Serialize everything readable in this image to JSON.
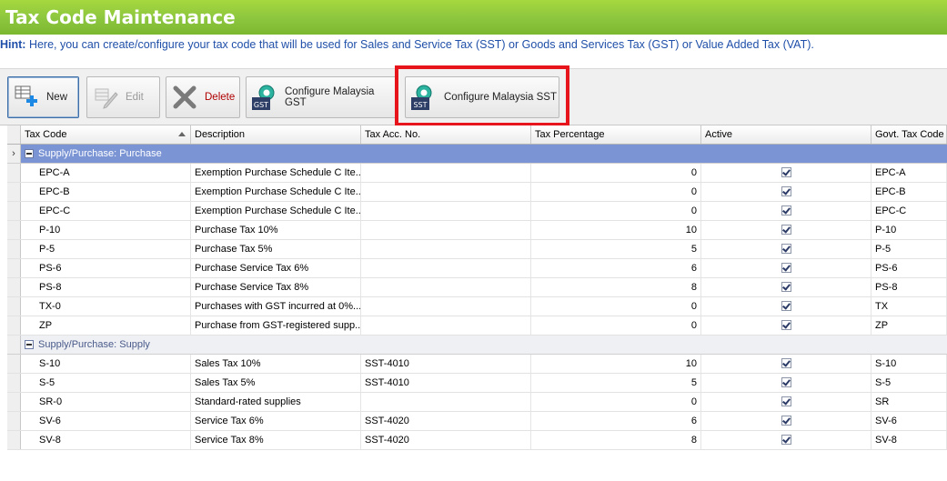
{
  "window": {
    "title": "Tax Code Maintenance"
  },
  "hint": {
    "prefix": "Hint:",
    "text": " Here, you can create/configure your tax code that will be used for Sales and Service Tax (SST) or Goods and Services Tax (GST) or Value Added Tax (VAT)."
  },
  "toolbar": {
    "new_label": "New",
    "edit_label": "Edit",
    "delete_label": "Delete",
    "gst_label": "Configure Malaysia GST",
    "gst_badge": "GST",
    "sst_label": "Configure Malaysia SST",
    "sst_badge": "SST"
  },
  "columns": [
    "Tax Code",
    "Description",
    "Tax Acc. No.",
    "Tax Percentage",
    "Active",
    "Govt. Tax Code"
  ],
  "groups": [
    {
      "label": "Supply/Purchase: Purchase",
      "rows": [
        {
          "code": "EPC-A",
          "desc": "Exemption Purchase Schedule C Ite...",
          "acc": "",
          "pct": "0",
          "active": true,
          "gov": "EPC-A"
        },
        {
          "code": "EPC-B",
          "desc": "Exemption Purchase Schedule C Ite...",
          "acc": "",
          "pct": "0",
          "active": true,
          "gov": "EPC-B"
        },
        {
          "code": "EPC-C",
          "desc": "Exemption Purchase Schedule C Ite...",
          "acc": "",
          "pct": "0",
          "active": true,
          "gov": "EPC-C"
        },
        {
          "code": "P-10",
          "desc": "Purchase Tax 10%",
          "acc": "",
          "pct": "10",
          "active": true,
          "gov": "P-10"
        },
        {
          "code": "P-5",
          "desc": "Purchase Tax 5%",
          "acc": "",
          "pct": "5",
          "active": true,
          "gov": "P-5"
        },
        {
          "code": "PS-6",
          "desc": "Purchase Service Tax 6%",
          "acc": "",
          "pct": "6",
          "active": true,
          "gov": "PS-6"
        },
        {
          "code": "PS-8",
          "desc": "Purchase Service Tax 8%",
          "acc": "",
          "pct": "8",
          "active": true,
          "gov": "PS-8"
        },
        {
          "code": "TX-0",
          "desc": "Purchases with GST incurred at 0%...",
          "acc": "",
          "pct": "0",
          "active": true,
          "gov": "TX"
        },
        {
          "code": "ZP",
          "desc": "Purchase from GST-registered supp...",
          "acc": "",
          "pct": "0",
          "active": true,
          "gov": "ZP"
        }
      ]
    },
    {
      "label": "Supply/Purchase: Supply",
      "rows": [
        {
          "code": "S-10",
          "desc": "Sales Tax 10%",
          "acc": "SST-4010",
          "pct": "10",
          "active": true,
          "gov": "S-10"
        },
        {
          "code": "S-5",
          "desc": "Sales Tax 5%",
          "acc": "SST-4010",
          "pct": "5",
          "active": true,
          "gov": "S-5"
        },
        {
          "code": "SR-0",
          "desc": "Standard-rated supplies",
          "acc": "",
          "pct": "0",
          "active": true,
          "gov": "SR"
        },
        {
          "code": "SV-6",
          "desc": "Service Tax 6%",
          "acc": "SST-4020",
          "pct": "6",
          "active": true,
          "gov": "SV-6"
        },
        {
          "code": "SV-8",
          "desc": "Service Tax 8%",
          "acc": "SST-4020",
          "pct": "8",
          "active": true,
          "gov": "SV-8"
        }
      ]
    }
  ],
  "colors": {
    "title_bar": "#8cc63f",
    "hint_text": "#1f4fa8",
    "group_selected": "#7b94d4",
    "highlight_box": "#e8141c"
  }
}
